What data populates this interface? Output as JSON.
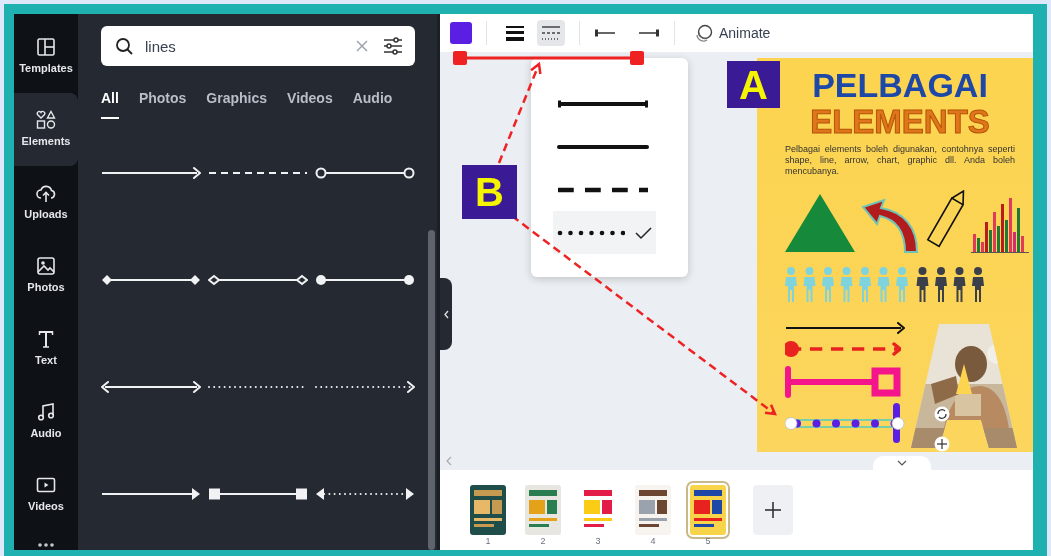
{
  "sidebar": {
    "items": [
      {
        "label": "Templates",
        "selected": false
      },
      {
        "label": "Elements",
        "selected": true
      },
      {
        "label": "Uploads",
        "selected": false
      },
      {
        "label": "Photos",
        "selected": false
      },
      {
        "label": "Text",
        "selected": false
      },
      {
        "label": "Audio",
        "selected": false
      },
      {
        "label": "Videos",
        "selected": false
      }
    ]
  },
  "search": {
    "value": "lines"
  },
  "tabs": [
    {
      "label": "All",
      "selected": true
    },
    {
      "label": "Photos",
      "selected": false
    },
    {
      "label": "Graphics",
      "selected": false
    },
    {
      "label": "Videos",
      "selected": false
    },
    {
      "label": "Audio",
      "selected": false
    }
  ],
  "toolbar": {
    "color_swatch": {
      "color": "#5b1fe3"
    },
    "style_menu_open": true,
    "animate_label": "Animate"
  },
  "line_style_menu": {
    "options": [
      {
        "kind": "thick",
        "selected": false
      },
      {
        "kind": "solid",
        "selected": false
      },
      {
        "kind": "dashed",
        "selected": false
      },
      {
        "kind": "dotted",
        "selected": true
      }
    ]
  },
  "poster": {
    "title": "PELBAGAI",
    "subtitle": "ELEMENTS",
    "text": "Pelbagai elements boleh digunakan, contohnya seperti shape, line, arrow, chart, graphic dll. Anda boleh mencubanya."
  },
  "pages": [
    {
      "number": "1",
      "selected": false
    },
    {
      "number": "2",
      "selected": false
    },
    {
      "number": "3",
      "selected": false
    },
    {
      "number": "4",
      "selected": false
    },
    {
      "number": "5",
      "selected": true
    }
  ],
  "annotations": [
    {
      "label": "A"
    },
    {
      "label": "B"
    }
  ]
}
